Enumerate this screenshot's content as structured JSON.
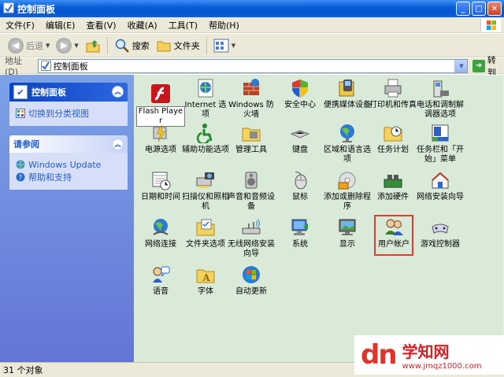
{
  "window": {
    "title": "控制面板"
  },
  "menu": [
    "文件(F)",
    "编辑(E)",
    "查看(V)",
    "收藏(A)",
    "工具(T)",
    "帮助(H)"
  ],
  "toolbar": {
    "back": "后退",
    "search": "搜索",
    "folders": "文件夹"
  },
  "address": {
    "label": "地址(D)",
    "value": "控制面板",
    "go": "转到"
  },
  "left": {
    "panel_title": "控制面板",
    "switch_view": "切换到分类视图",
    "see_also_title": "请参阅",
    "see_also": [
      "Windows Update",
      "帮助和支持"
    ]
  },
  "items": [
    {
      "label": "Flash Player"
    },
    {
      "label": "Internet 选项"
    },
    {
      "label": "Windows 防火墙"
    },
    {
      "label": "安全中心"
    },
    {
      "label": "便携媒体设备"
    },
    {
      "label": "打印机和传真"
    },
    {
      "label": "电话和调制解调器选项"
    },
    {
      "label": "电源选项"
    },
    {
      "label": "辅助功能选项"
    },
    {
      "label": "管理工具"
    },
    {
      "label": "键盘"
    },
    {
      "label": "区域和语言选项"
    },
    {
      "label": "任务计划"
    },
    {
      "label": "任务栏和「开始」菜单"
    },
    {
      "label": "日期和时间"
    },
    {
      "label": "扫描仪和照相机"
    },
    {
      "label": "声音和音频设备"
    },
    {
      "label": "鼠标"
    },
    {
      "label": "添加或删除程序"
    },
    {
      "label": "添加硬件"
    },
    {
      "label": "网络安装向导"
    },
    {
      "label": "网络连接"
    },
    {
      "label": "文件夹选项"
    },
    {
      "label": "无线网络安装向导"
    },
    {
      "label": "系统"
    },
    {
      "label": "显示"
    },
    {
      "label": "用户帐户"
    },
    {
      "label": "游戏控制器"
    },
    {
      "label": "语音"
    },
    {
      "label": "字体"
    },
    {
      "label": "自动更新"
    }
  ],
  "status": {
    "text": "31 个对象"
  },
  "watermark": {
    "logo": "dn",
    "site_name": "学知网",
    "site_url": "www.jmqz1000.com"
  },
  "colors": {
    "title_bar": "#0653d0",
    "main_bg": "#d9ead8",
    "left_pane": "#6d8ce0",
    "highlight": "#e63a2a"
  }
}
